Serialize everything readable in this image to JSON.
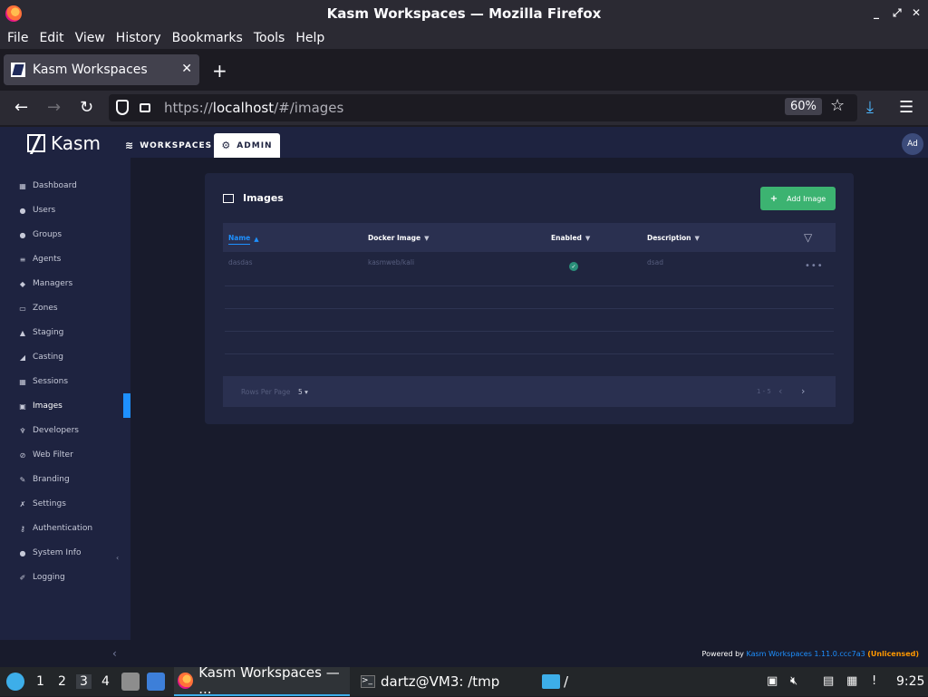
{
  "window": {
    "title": "Kasm Workspaces — Mozilla Firefox",
    "controls": [
      "×",
      "⤢",
      "✕"
    ]
  },
  "menubar": [
    "File",
    "Edit",
    "View",
    "History",
    "Bookmarks",
    "Tools",
    "Help"
  ],
  "tabs": [
    {
      "title": "Kasm Workspaces",
      "active": true
    }
  ],
  "newtab_label": "+",
  "nav": {
    "url_prefix": "https://",
    "url_host": "localhost",
    "url_path": "/#/images",
    "zoom": "60%"
  },
  "app": {
    "logo_text": "Kasm",
    "top_nav": [
      {
        "label": "WORKSPACES",
        "icon": "layers-icon"
      },
      {
        "label": "ADMIN",
        "icon": "gear-icon",
        "active": true
      }
    ],
    "avatar": "Ad",
    "sidebar": [
      {
        "label": "Dashboard",
        "icon": "grid-icon"
      },
      {
        "label": "Users",
        "icon": "user-icon"
      },
      {
        "label": "Groups",
        "icon": "users-icon"
      },
      {
        "label": "Agents",
        "icon": "list-icon"
      },
      {
        "label": "Managers",
        "icon": "shield-icon"
      },
      {
        "label": "Zones",
        "icon": "map-icon"
      },
      {
        "label": "Staging",
        "icon": "flask-icon"
      },
      {
        "label": "Casting",
        "icon": "cast-icon"
      },
      {
        "label": "Sessions",
        "icon": "table-icon"
      },
      {
        "label": "Images",
        "icon": "image-icon",
        "active": true
      },
      {
        "label": "Developers",
        "icon": "code-icon"
      },
      {
        "label": "Web Filter",
        "icon": "filter-icon"
      },
      {
        "label": "Branding",
        "icon": "brush-icon"
      },
      {
        "label": "Settings",
        "icon": "wrench-icon"
      },
      {
        "label": "Authentication",
        "icon": "key-icon"
      },
      {
        "label": "System Info",
        "icon": "info-icon"
      },
      {
        "label": "Logging",
        "icon": "pen-icon"
      }
    ],
    "panel": {
      "title": "Images",
      "add_button": "Add Image",
      "columns": [
        "Name",
        "Docker Image",
        "Enabled",
        "Description"
      ],
      "rows": [
        {
          "name": "dasdas",
          "docker_image": "kasmweb/kali",
          "enabled": true,
          "description": "dsad"
        }
      ],
      "rows_per_page_label": "Rows Per Page",
      "rows_per_page_value": "5",
      "page_range": "1 - 5"
    },
    "footer": {
      "powered_by": "Powered by",
      "version": "Kasm Workspaces 1.11.0.ccc7a3",
      "license": "(Unlicensed)"
    }
  },
  "taskbar": {
    "workspaces": [
      "1",
      "2",
      "3",
      "4"
    ],
    "active_workspace": "3",
    "tasks": [
      {
        "label": "Kasm Workspaces — ...",
        "icon": "firefox-icon"
      },
      {
        "label": "dartz@VM3: /tmp",
        "icon": "terminal-icon"
      },
      {
        "label": "/",
        "icon": "folder-icon"
      }
    ],
    "clock": "9:25"
  },
  "colors": {
    "accent": "#1e90ff",
    "add_button": "#3cb371",
    "license": "#ff9800"
  }
}
